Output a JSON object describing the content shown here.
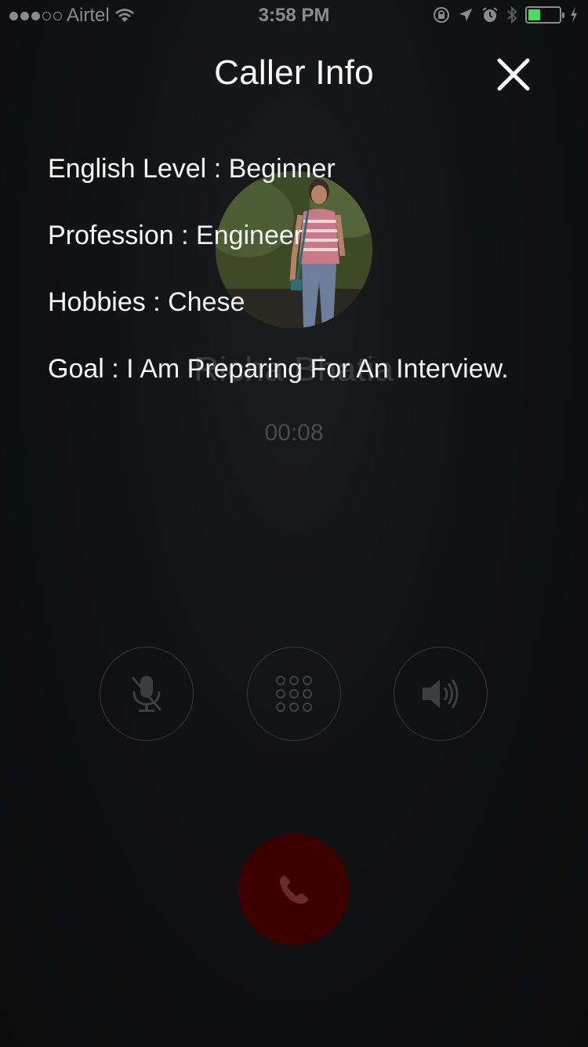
{
  "status_bar": {
    "carrier": "Airtel",
    "signal_bars_filled": 3,
    "signal_bars_total": 5,
    "time": "3:58 PM",
    "battery_level": 0.45,
    "icons": [
      "wifi-icon",
      "orientation-lock-icon",
      "location-icon",
      "alarm-icon",
      "bluetooth-icon",
      "battery-icon",
      "charging-icon"
    ]
  },
  "call": {
    "caller_name": "Richa Bhatia",
    "timer": "00:08",
    "controls": [
      "mute-icon",
      "keypad-icon",
      "speaker-icon"
    ],
    "end_call_icon": "phone-icon"
  },
  "caller_info": {
    "title": "Caller Info",
    "close_icon": "close-icon",
    "fields": [
      {
        "label": "English Level",
        "value": "Beginner"
      },
      {
        "label": "Profession",
        "value": "Engineer"
      },
      {
        "label": "Hobbies",
        "value": "Chese"
      },
      {
        "label": "Goal",
        "value": "I Am Preparing For An Interview."
      }
    ]
  },
  "colors": {
    "background": "#0b0b0c",
    "overlay_text": "#ffffff",
    "dimmed_text": "#3a3b3d",
    "end_call": "#3d0000",
    "battery_fill": "#4cd964"
  }
}
